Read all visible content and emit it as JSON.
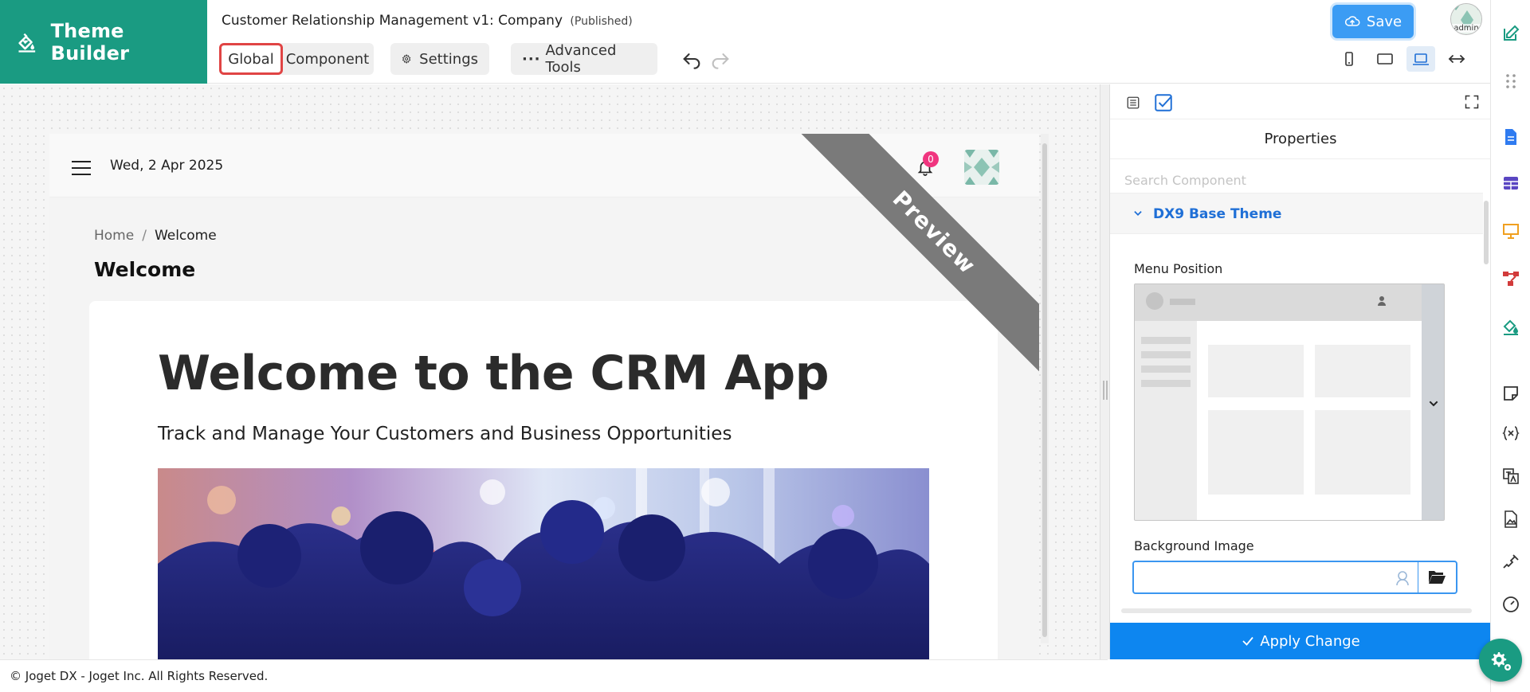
{
  "brand": {
    "title": "Theme Builder"
  },
  "app": {
    "title": "Customer Relationship Management v1: Company",
    "status": "(Published)"
  },
  "toolbar": {
    "global_label": "Global",
    "component_label": "Component",
    "settings_label": "Settings",
    "advanced_label": "Advanced Tools",
    "save_label": "Save",
    "avatar_text": "admin"
  },
  "preview": {
    "date": "Wed, 2 Apr 2025",
    "notification_count": "0",
    "breadcrumb": {
      "home": "Home",
      "separator": "/",
      "current": "Welcome"
    },
    "page_heading": "Welcome",
    "welcome_title": "Welcome to the CRM App",
    "welcome_subtitle": "Track and Manage Your Customers and Business Opportunities",
    "ribbon": "Preview"
  },
  "panel": {
    "title": "Properties",
    "search_placeholder": "Search Component",
    "theme_name": "DX9 Base Theme",
    "menu_position_label": "Menu Position",
    "background_image_label": "Background Image",
    "background_image_value": "",
    "apply_label": "Apply Change"
  },
  "footer": {
    "text": "© Joget DX - Joget Inc. All Rights Reserved."
  },
  "colors": {
    "brand": "#1a9b82",
    "save": "#3b9cf4",
    "apply": "#0d86f0",
    "highlight": "#e04444",
    "badge": "#f0357f"
  }
}
